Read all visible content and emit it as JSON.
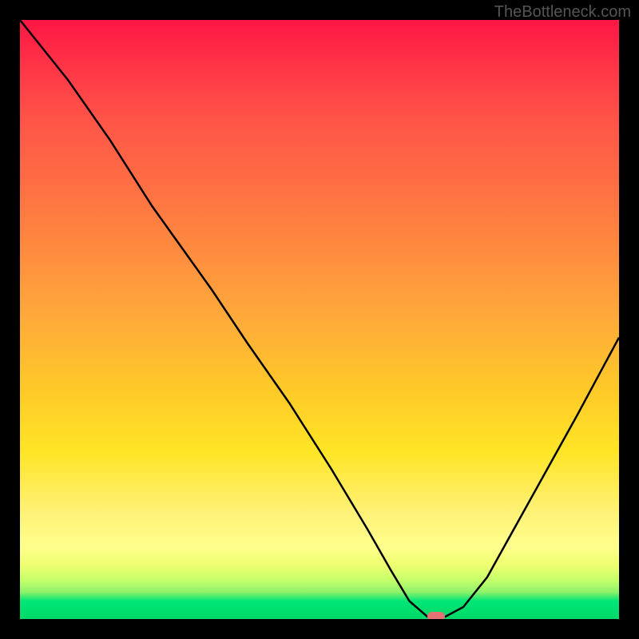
{
  "watermark": "TheBottleneck.com",
  "chart_data": {
    "type": "line",
    "title": "",
    "xlabel": "",
    "ylabel": "",
    "xlim": [
      0,
      100
    ],
    "ylim": [
      0,
      100
    ],
    "series": [
      {
        "name": "curve",
        "x": [
          0,
          8,
          15,
          22,
          27,
          32,
          38,
          45,
          52,
          58,
          62,
          65,
          68,
          71,
          74,
          78,
          83,
          88,
          93,
          100
        ],
        "values": [
          100,
          90,
          80,
          69,
          62,
          55,
          46,
          36,
          25,
          15,
          8,
          3,
          0.4,
          0.4,
          2,
          7,
          16,
          25,
          34,
          47
        ]
      }
    ],
    "marker": {
      "x": 69.5,
      "y": 0.4,
      "color": "#e57373"
    },
    "gradient_stops": [
      {
        "pos": 0,
        "color": "#ff1744"
      },
      {
        "pos": 0.1,
        "color": "#ff3d47"
      },
      {
        "pos": 0.17,
        "color": "#ff5548"
      },
      {
        "pos": 0.28,
        "color": "#ff7043"
      },
      {
        "pos": 0.38,
        "color": "#ff8a3f"
      },
      {
        "pos": 0.5,
        "color": "#ffab3a"
      },
      {
        "pos": 0.62,
        "color": "#ffca28"
      },
      {
        "pos": 0.72,
        "color": "#ffe526"
      },
      {
        "pos": 0.82,
        "color": "#fff176"
      },
      {
        "pos": 0.88,
        "color": "#ffff8d"
      },
      {
        "pos": 0.91,
        "color": "#eeff70"
      },
      {
        "pos": 0.935,
        "color": "#c6ff6b"
      },
      {
        "pos": 0.955,
        "color": "#8ef26a"
      },
      {
        "pos": 0.97,
        "color": "#00e676"
      },
      {
        "pos": 1.0,
        "color": "#00d968"
      }
    ]
  }
}
